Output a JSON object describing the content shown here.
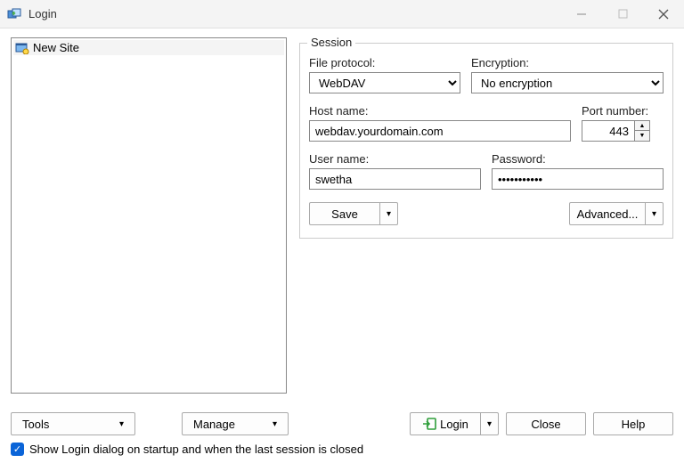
{
  "window": {
    "title": "Login"
  },
  "sitelist": {
    "items": [
      {
        "label": "New Site"
      }
    ]
  },
  "session": {
    "legend": "Session",
    "file_protocol_label": "File protocol:",
    "file_protocol_value": "WebDAV",
    "encryption_label": "Encryption:",
    "encryption_value": "No encryption",
    "host_label": "Host name:",
    "host_value": "webdav.yourdomain.com",
    "port_label": "Port number:",
    "port_value": "443",
    "user_label": "User name:",
    "user_value": "swetha",
    "password_label": "Password:",
    "password_value": "•••••••••••",
    "save_label": "Save",
    "advanced_label": "Advanced..."
  },
  "toolbar": {
    "tools_label": "Tools",
    "manage_label": "Manage",
    "login_label": "Login",
    "close_label": "Close",
    "help_label": "Help"
  },
  "checkbox": {
    "label": "Show Login dialog on startup and when the last session is closed",
    "checked": true
  }
}
